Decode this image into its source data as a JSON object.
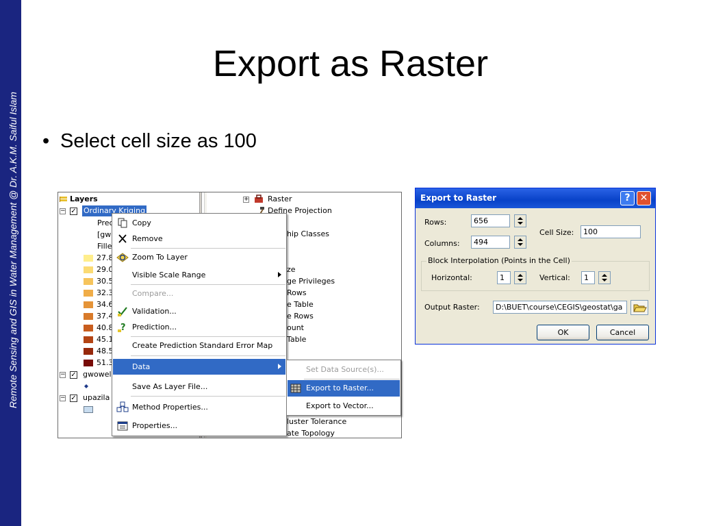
{
  "slide": {
    "title": "Export as Raster",
    "bullet": "Select cell size as 100",
    "side_text": "Remote Sensing and GIS in Water Management  @ Dr. A.K.M. Saiful Islam",
    "colors": {
      "side_bar": "#1a2580",
      "menu_highlight": "#316ac5",
      "dialog_title": "#0842c8"
    }
  },
  "toc": {
    "root": "Layers",
    "layer1": "Ordinary Kriging",
    "layer1_rows": [
      "Prec",
      "[gwo",
      "Fillec"
    ],
    "classes": [
      {
        "label": "27.8",
        "color": "#ffee8c"
      },
      {
        "label": "29.0",
        "color": "#fbdb74"
      },
      {
        "label": "30.5",
        "color": "#f6c45c"
      },
      {
        "label": "32.3",
        "color": "#f0ad48"
      },
      {
        "label": "34.6",
        "color": "#e59438"
      },
      {
        "label": "37.4",
        "color": "#d87a2a"
      },
      {
        "label": "40.8",
        "color": "#c85d1e"
      },
      {
        "label": "45.1",
        "color": "#b34414"
      },
      {
        "label": "48.5",
        "color": "#97290c"
      },
      {
        "label": "51.3",
        "color": "#780c06"
      }
    ],
    "layer2": "gwowell_",
    "layer3": "upazila"
  },
  "catalog": {
    "items": [
      "Raster",
      "Define Projection",
      "hip Classes",
      "ze",
      "ge Privileges",
      "Rows",
      "e Table",
      "e Rows",
      "ount",
      "Table",
      "luster Tolerance",
      "ate Topology"
    ]
  },
  "context_menu": {
    "items": [
      {
        "label": "Copy",
        "icon": "copy-icon",
        "disabled": false
      },
      {
        "label": "Remove",
        "icon": "remove-x-icon",
        "disabled": false
      },
      {
        "label": "Zoom To Layer",
        "icon": "zoom-to-layer-icon",
        "disabled": false
      },
      {
        "label": "Visible Scale Range",
        "icon": "",
        "disabled": false
      },
      {
        "label": "Compare...",
        "icon": "",
        "disabled": true
      },
      {
        "label": "Validation...",
        "icon": "validation-icon",
        "disabled": false
      },
      {
        "label": "Prediction...",
        "icon": "prediction-icon",
        "disabled": false
      },
      {
        "label": "Create Prediction Standard Error Map",
        "icon": "",
        "disabled": false
      },
      {
        "label": "Data",
        "icon": "",
        "disabled": false
      },
      {
        "label": "Save As Layer File...",
        "icon": "",
        "disabled": false
      },
      {
        "label": "Method Properties...",
        "icon": "method-properties-icon",
        "disabled": false
      },
      {
        "label": "Properties...",
        "icon": "properties-icon",
        "disabled": false
      }
    ]
  },
  "submenu": {
    "items": [
      {
        "label": "Set Data Source(s)...",
        "disabled": true
      },
      {
        "label": "Export to Raster...",
        "disabled": false
      },
      {
        "label": "Export to Vector...",
        "disabled": false
      }
    ]
  },
  "dialog": {
    "title": "Export to Raster",
    "help": "?",
    "close": "✕",
    "rows_label": "Rows:",
    "rows_value": "656",
    "columns_label": "Columns:",
    "columns_value": "494",
    "cell_size_label": "Cell Size:",
    "cell_size_value": "100",
    "block_group_label": "Block Interpolation (Points in the Cell)",
    "horizontal_label": "Horizontal:",
    "horizontal_value": "1",
    "vertical_label": "Vertical:",
    "vertical_value": "1",
    "output_label": "Output Raster:",
    "output_value": "D:\\BUET\\course\\CEGIS\\geostat\\ga",
    "ok_label": "OK",
    "cancel_label": "Cancel"
  }
}
